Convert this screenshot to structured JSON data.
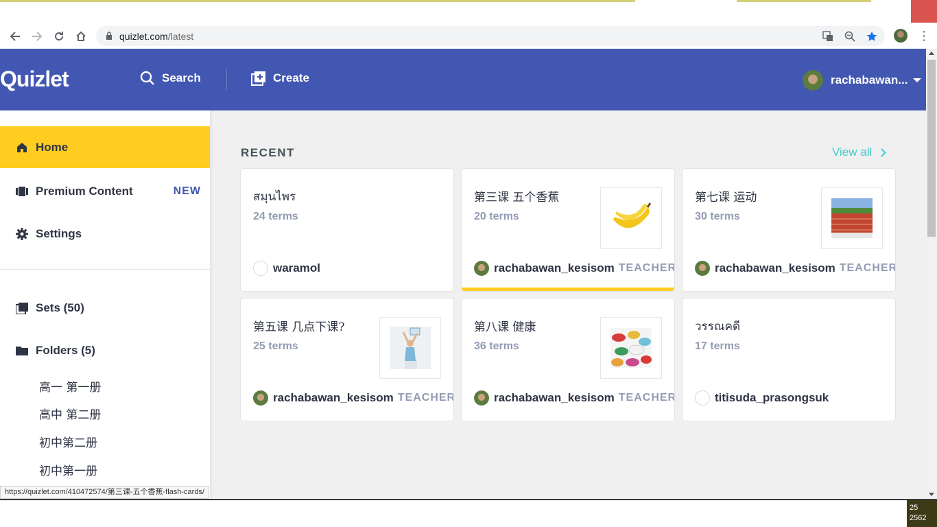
{
  "browser": {
    "url_host": "quizlet.com",
    "url_path": "/latest",
    "status_url": "https://quizlet.com/410472574/第三课-五个香蕉-flash-cards/"
  },
  "header": {
    "logo": "Quizlet",
    "search_label": "Search",
    "create_label": "Create",
    "username": "rachabawan..."
  },
  "sidebar": {
    "home": "Home",
    "premium": "Premium Content",
    "premium_badge": "NEW",
    "settings": "Settings",
    "sets": "Sets (50)",
    "folders": "Folders (5)",
    "folder_items": [
      "高一 第一册",
      "高中 第二册",
      "初中第二册",
      "初中第一册"
    ]
  },
  "main": {
    "recent_label": "RECENT",
    "view_all": "View all",
    "cards": [
      {
        "title": "สมุนไพร",
        "terms": "24 terms",
        "owner": "waramol",
        "badge": "",
        "thumb": "none"
      },
      {
        "title": "第三课 五个香蕉",
        "terms": "20 terms",
        "owner": "rachabawan_kesisom",
        "badge": "TEACHER",
        "thumb": "banana"
      },
      {
        "title": "第七课 运动",
        "terms": "30 terms",
        "owner": "rachabawan_kesisom",
        "badge": "TEACHER",
        "thumb": "track"
      },
      {
        "title": "第五课 几点下课?",
        "terms": "25 terms",
        "owner": "rachabawan_kesisom",
        "badge": "TEACHER",
        "thumb": "woman"
      },
      {
        "title": "第八课 健康",
        "terms": "36 terms",
        "owner": "rachabawan_kesisom",
        "badge": "TEACHER",
        "thumb": "pills"
      },
      {
        "title": "วรรณคดี",
        "terms": "17 terms",
        "owner": "titisuda_prasongsuk",
        "badge": "",
        "thumb": "none"
      }
    ]
  },
  "taskbar": {
    "tray_line1": "25",
    "tray_line2": "2562"
  },
  "colors": {
    "header": "#4257b2",
    "accent_yellow": "#ffcd1f",
    "view_all": "#3ccfcf"
  }
}
